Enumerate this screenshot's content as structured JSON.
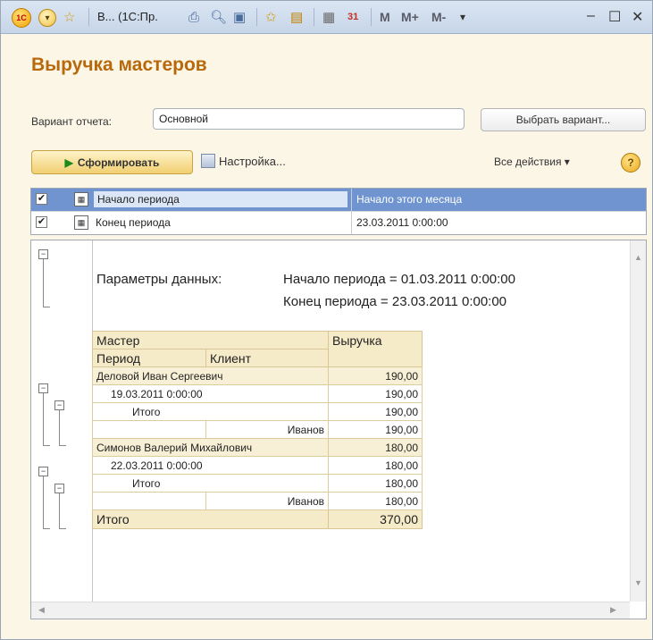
{
  "titlebar": {
    "title": "В...  (1С:Пр.",
    "logo_text": "1С",
    "m_label": "M",
    "m_plus_label": "M+",
    "m_minus_label": "M-"
  },
  "page": {
    "title": "Выручка мастеров"
  },
  "variant": {
    "label": "Вариант отчета:",
    "value": "Основной",
    "choose_button": "Выбрать вариант..."
  },
  "toolbar": {
    "generate_label": "Сформировать",
    "settings_label": "Настройка...",
    "all_actions_label": "Все действия ▾",
    "help_label": "?"
  },
  "parameters": [
    {
      "checked": true,
      "name": "Начало периода",
      "value": "Начало этого месяца",
      "selected": true
    },
    {
      "checked": true,
      "name": "Конец периода",
      "value": "23.03.2011 0:00:00",
      "selected": false
    }
  ],
  "report": {
    "params_label": "Параметры данных:",
    "params_line1": "Начало периода = 01.03.2011 0:00:00",
    "params_line2": "Конец периода = 23.03.2011 0:00:00",
    "headers": {
      "master": "Мастер",
      "revenue": "Выручка",
      "period": "Период",
      "client": "Клиент"
    },
    "rows": [
      {
        "type": "group",
        "label": "Деловой Иван Сергеевич",
        "value": "190,00"
      },
      {
        "type": "period",
        "label": "19.03.2011 0:00:00",
        "value": "190,00"
      },
      {
        "type": "subtotal",
        "label": "Итого",
        "value": "190,00"
      },
      {
        "type": "client",
        "label": "Иванов",
        "value": "190,00"
      },
      {
        "type": "group",
        "label": "Симонов Валерий Михайлович",
        "value": "180,00"
      },
      {
        "type": "period",
        "label": "22.03.2011 0:00:00",
        "value": "180,00"
      },
      {
        "type": "subtotal",
        "label": "Итого",
        "value": "180,00"
      },
      {
        "type": "client",
        "label": "Иванов",
        "value": "180,00"
      }
    ],
    "total_label": "Итого",
    "total_value": "370,00"
  }
}
